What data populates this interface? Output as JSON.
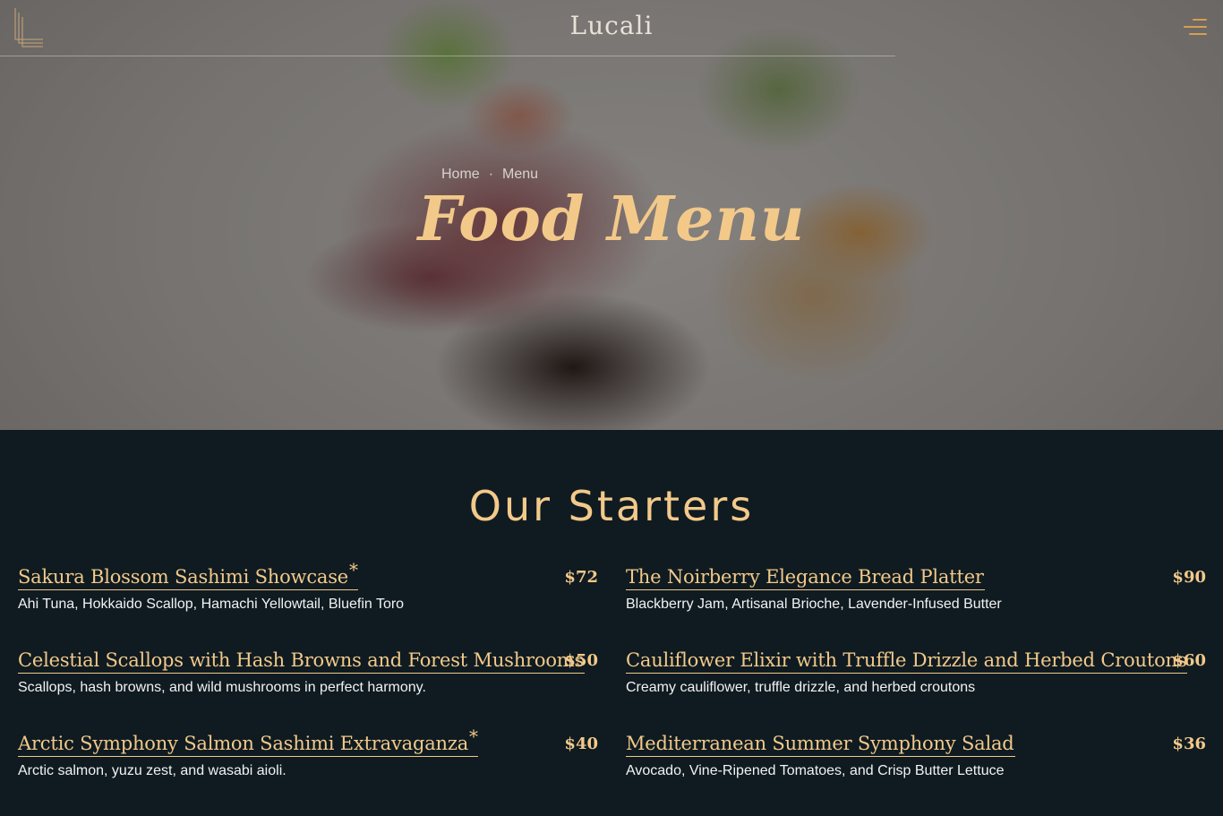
{
  "header": {
    "site_name": "Lucali",
    "logo_icon": "lucali-logo-lines-icon",
    "menu_icon": "hamburger-menu-icon",
    "accent_color": "#d79e55"
  },
  "hero": {
    "breadcrumb": [
      "Home",
      "Menu"
    ],
    "title": "Food Menu",
    "title_color": "#f3c98a"
  },
  "section": {
    "title": "Our Starters",
    "background": "#0f1b21"
  },
  "items": [
    {
      "name": "Sakura Blossom Sashimi Showcase",
      "star": "*",
      "price": "$72",
      "desc": "Ahi Tuna, Hokkaido Scallop, Hamachi Yellowtail, Bluefin Toro"
    },
    {
      "name": "The Noirberry Elegance Bread Platter",
      "star": "",
      "price": "$90",
      "desc": "Blackberry Jam, Artisanal Brioche, Lavender-Infused Butter"
    },
    {
      "name": "Celestial Scallops with Hash Browns and Forest Mushrooms",
      "star": "",
      "price": "$50",
      "desc": "Scallops, hash browns, and wild mushrooms in perfect harmony."
    },
    {
      "name": "Cauliflower Elixir with Truffle Drizzle and Herbed Croutons",
      "star": "",
      "price": "$60",
      "desc": "Creamy cauliflower, truffle drizzle, and herbed croutons"
    },
    {
      "name": "Arctic Symphony Salmon Sashimi Extravaganza",
      "star": "*",
      "price": "$40",
      "desc": "Arctic salmon, yuzu zest, and wasabi aioli."
    },
    {
      "name": "Mediterranean Summer Symphony Salad",
      "star": "",
      "price": "$36",
      "desc": "Avocado, Vine-Ripened Tomatoes, and Crisp Butter Lettuce"
    }
  ]
}
